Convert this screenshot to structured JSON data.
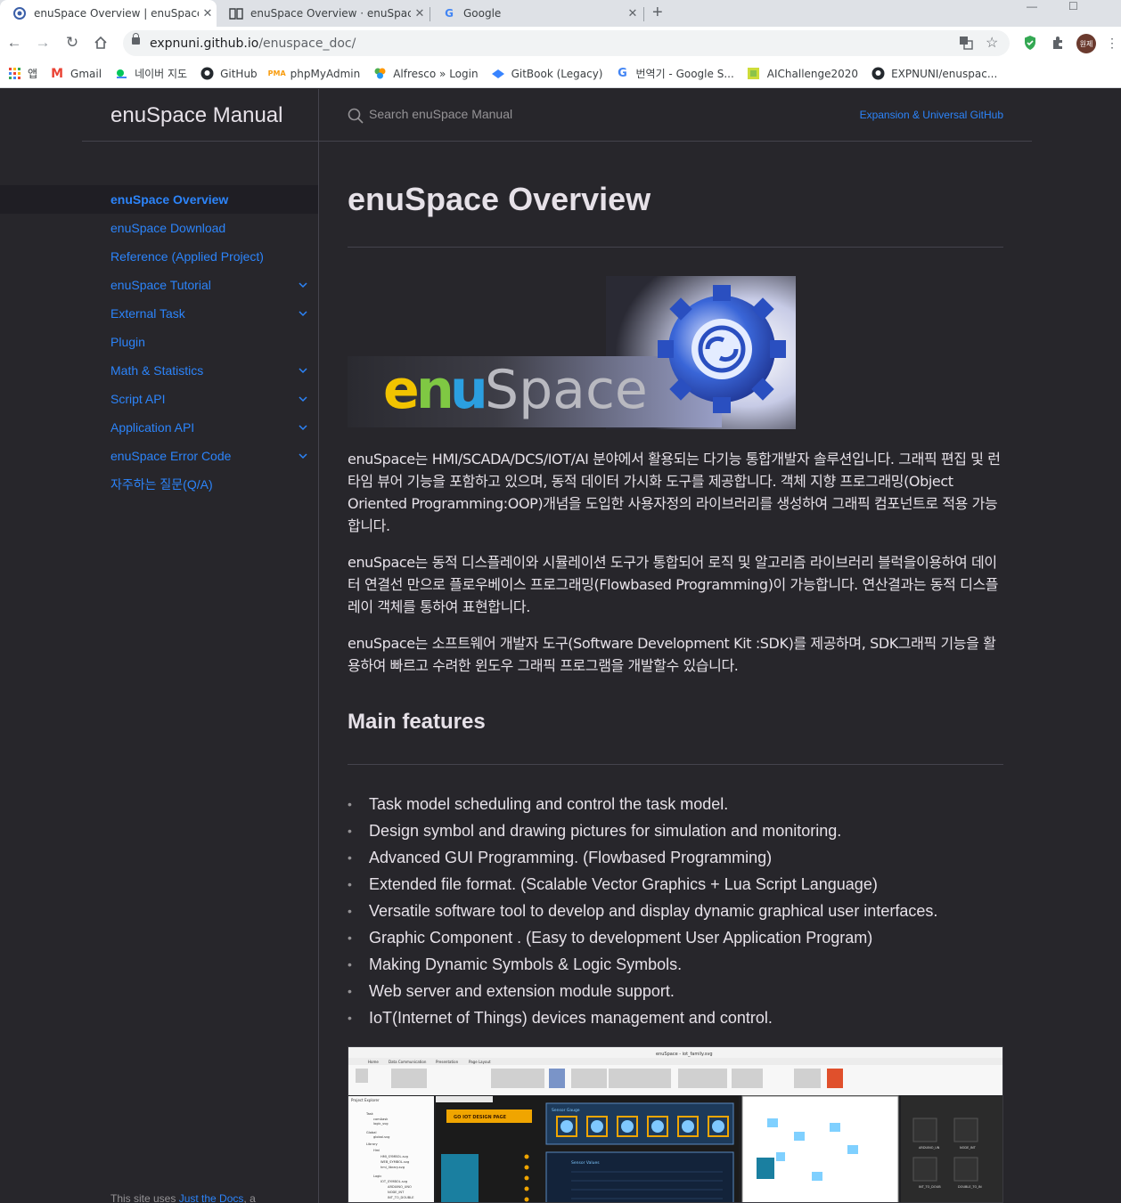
{
  "browser": {
    "tabs": [
      {
        "title": "enuSpace Overview | enuSpace",
        "icon": "enuspace-favicon-icon"
      },
      {
        "title": "enuSpace Overview · enuSpace",
        "icon": "book-icon"
      },
      {
        "title": "Google",
        "icon": "google-icon"
      }
    ],
    "url_host": "expnuni.github.io",
    "url_path": "/enuspace_doc/",
    "profile_initials": "원제",
    "bookmarks": [
      {
        "label": "앱",
        "icon": "apps-grid-icon",
        "color": "#ea4335"
      },
      {
        "label": "Gmail",
        "icon": "gmail-icon",
        "color": "#ea4335"
      },
      {
        "label": "네이버 지도",
        "icon": "naver-map-icon",
        "color": "#03c75a"
      },
      {
        "label": "GitHub",
        "icon": "github-icon",
        "color": "#24292e"
      },
      {
        "label": "phpMyAdmin",
        "icon": "phpmyadmin-icon",
        "color": "#f89c0e"
      },
      {
        "label": "Alfresco » Login",
        "icon": "alfresco-icon",
        "color": "#4caf50"
      },
      {
        "label": "GitBook (Legacy)",
        "icon": "gitbook-icon",
        "color": "#3884ff"
      },
      {
        "label": "번역기 - Google S...",
        "icon": "google-icon",
        "color": "#4285f4"
      },
      {
        "label": "AIChallenge2020",
        "icon": "aichallenge-icon",
        "color": "#8bc34a"
      },
      {
        "label": "EXPNUNI/enuspac...",
        "icon": "github-icon",
        "color": "#24292e"
      }
    ]
  },
  "site": {
    "title": "enuSpace Manual",
    "search_placeholder": "Search enuSpace Manual",
    "aux_link": "Expansion & Universal GitHub",
    "nav": [
      {
        "label": "enuSpace Overview",
        "active": true,
        "expandable": false
      },
      {
        "label": "enuSpace Download",
        "active": false,
        "expandable": false
      },
      {
        "label": "Reference (Applied Project)",
        "active": false,
        "expandable": false
      },
      {
        "label": "enuSpace Tutorial",
        "active": false,
        "expandable": true
      },
      {
        "label": "External Task",
        "active": false,
        "expandable": true
      },
      {
        "label": "Plugin",
        "active": false,
        "expandable": false
      },
      {
        "label": "Math & Statistics",
        "active": false,
        "expandable": true
      },
      {
        "label": "Script API",
        "active": false,
        "expandable": true
      },
      {
        "label": "Application API",
        "active": false,
        "expandable": true
      },
      {
        "label": "enuSpace Error Code",
        "active": false,
        "expandable": true
      },
      {
        "label": "자주하는 질문(Q/A)",
        "active": false,
        "expandable": false
      }
    ],
    "footer_prefix": "This site uses ",
    "footer_link": "Just the Docs",
    "footer_suffix": ", a"
  },
  "page": {
    "title": "enuSpace Overview",
    "logo_text": "enuSpace",
    "paragraphs": [
      "enuSpace는 HMI/SCADA/DCS/IOT/AI 분야에서 활용되는 다기능 통합개발자 솔루션입니다. 그래픽 편집 및 런타임 뷰어 기능을 포함하고 있으며, 동적 데이터 가시화 도구를 제공합니다. 객체 지향 프로그래밍(Object Oriented Programming:OOP)개념을 도입한 사용자정의 라이브러리를 생성하여 그래픽 컴포넌트로 적용 가능합니다.",
      "enuSpace는 동적 디스플레이와 시뮬레이션 도구가 통합되어 로직 및 알고리즘 라이브러리 블럭을이용하여 데이터 연결선 만으로 플로우베이스 프로그래밍(Flowbased Programming)이 가능합니다. 연산결과는 동적 디스플레이 객체를 통하여 표현합니다.",
      "enuSpace는 소프트웨어 개발자 도구(Software Development Kit :SDK)를 제공하며, SDK그래픽 기능을 활용하여 빠르고 수려한 윈도우 그래픽 프로그램을 개발할수 있습니다."
    ],
    "features_heading": "Main features",
    "features": [
      "Task model scheduling and control the task model.",
      "Design symbol and drawing pictures for simulation and monitoring.",
      "Advanced GUI Programming. (Flowbased Programming)",
      "Extended file format. (Scalable Vector Graphics + Lua Script Language)",
      "Versatile software tool to develop and display dynamic graphical user interfaces.",
      "Graphic Component . (Easy to development User Application Program)",
      "Making Dynamic Symbols & Logic Symbols.",
      "Web server and extension module support.",
      "IoT(Internet of Things) devices management and control."
    ],
    "screenshot": {
      "window_title": "enuSpace - iot_family.svg",
      "ribbon_tabs": [
        "Home",
        "Data Communication",
        "Presentation",
        "Page Layout"
      ],
      "banner": "GO IOT DESIGN PAGE",
      "panel_gauge": "Sensor Gauge",
      "panel_values": "Sensor Values",
      "explorer_title": "Project Explorer",
      "tree": [
        "Task",
        "comAask",
        "logic_svg",
        "Global",
        "global.svg",
        "Library",
        "Hmi",
        "HMI_SYMBOL.svg",
        "WEB_SYMBOL.svg",
        "hmi_library.svg",
        "Logic",
        "IOT_SYMBOL.svg",
        "ARDUINO_UNO",
        "NODE_INT",
        "INT_TO_DOUBLE"
      ],
      "symbol_labels": [
        "ARDUINO_UN",
        "NODE_INT",
        "INT_TO_DOUB",
        "DOUBLE_TO_IN"
      ]
    }
  },
  "colors": {
    "background": "#27262b",
    "link": "#2c84fa",
    "text": "#e6e1e8",
    "muted": "#959396"
  }
}
